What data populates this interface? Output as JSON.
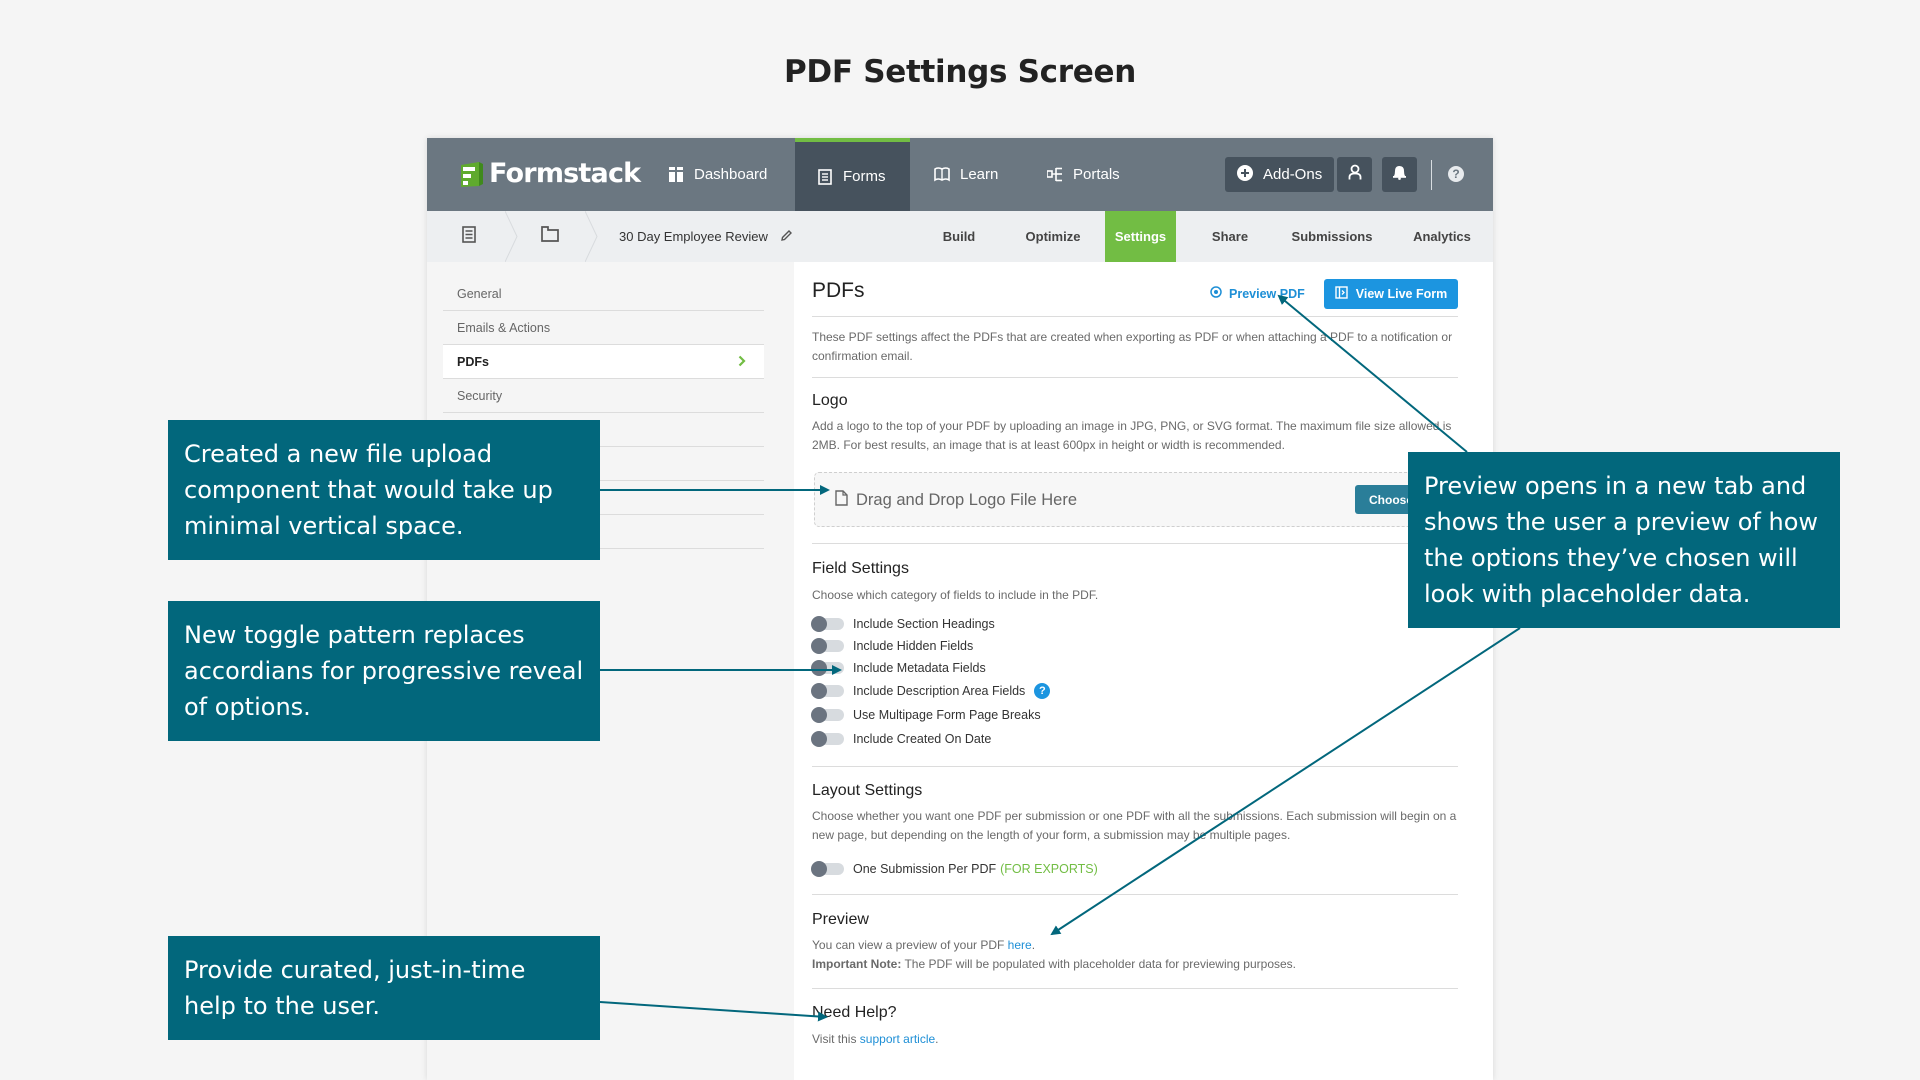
{
  "page_title": "PDF Settings Screen",
  "app": {
    "logo_text": "Formstack",
    "nav": [
      {
        "label": "Dashboard",
        "icon": "dashboard-icon",
        "active": false
      },
      {
        "label": "Forms",
        "icon": "forms-icon",
        "active": true
      },
      {
        "label": "Learn",
        "icon": "book-icon",
        "active": false
      },
      {
        "label": "Portals",
        "icon": "portals-icon",
        "active": false
      }
    ],
    "addons_label": "Add-Ons",
    "accent_green": "#72bd44",
    "accent_blue": "#1c95e0"
  },
  "subnav": {
    "form_name": "30 Day Employee Review",
    "tabs": [
      {
        "label": "Build",
        "active": false
      },
      {
        "label": "Optimize",
        "active": false
      },
      {
        "label": "Settings",
        "active": true
      },
      {
        "label": "Share",
        "active": false
      },
      {
        "label": "Submissions",
        "active": false
      },
      {
        "label": "Analytics",
        "active": false
      }
    ]
  },
  "sidebar": {
    "items": [
      {
        "label": "General",
        "active": false
      },
      {
        "label": "Emails & Actions",
        "active": false
      },
      {
        "label": "PDFs",
        "active": true
      },
      {
        "label": "Security",
        "active": false
      },
      {
        "label": "",
        "active": false
      },
      {
        "label": "",
        "active": false
      },
      {
        "label": "",
        "active": false
      },
      {
        "label": "",
        "active": false
      }
    ]
  },
  "main": {
    "title": "PDFs",
    "preview_pdf_label": "Preview PDF",
    "view_live_form_label": "View Live Form",
    "intro": "These PDF settings affect the PDFs that are created when exporting as PDF or when attaching a PDF to a notification or confirmation email.",
    "logo": {
      "heading": "Logo",
      "description": "Add a logo to the top of your PDF by uploading an image in JPG, PNG, or SVG format. The maximum file size allowed is 2MB. For best results, an image that is at least 600px in height or width is recommended.",
      "dropzone_text": "Drag and Drop Logo File Here",
      "choose_button": "Choose File"
    },
    "field_settings": {
      "heading": "Field Settings",
      "description": "Choose which category of fields to include in the PDF.",
      "toggles": [
        {
          "label": "Include Section Headings",
          "on": false
        },
        {
          "label": "Include Hidden Fields",
          "on": false
        },
        {
          "label": "Include Metadata Fields",
          "on": false
        },
        {
          "label": "Include Description Area Fields",
          "on": false,
          "help": true
        },
        {
          "label": "Use Multipage Form Page Breaks",
          "on": false
        },
        {
          "label": "Include Created On Date",
          "on": false
        }
      ]
    },
    "layout_settings": {
      "heading": "Layout Settings",
      "description": "Choose whether you want one PDF per submission or one PDF with all the submissions. Each submission will begin on a new page, but depending on the length of your form, a submission may be multiple pages.",
      "toggle_label": "One Submission Per PDF",
      "toggle_note": "(FOR EXPORTS)",
      "toggle_on": false
    },
    "preview": {
      "heading": "Preview",
      "line1_prefix": "You can view a preview of your PDF ",
      "line1_link": "here",
      "line1_suffix": ".",
      "note_label": "Important Note:",
      "note_text": " The PDF will be populated with placeholder data for previewing purposes."
    },
    "help": {
      "heading": "Need Help?",
      "prefix": "Visit this ",
      "link": "support article",
      "suffix": "."
    }
  },
  "callouts": [
    {
      "text": "Created a new file upload component that would take up minimal vertical space."
    },
    {
      "text": "New toggle pattern replaces accordians for progressive reveal of options."
    },
    {
      "text": "Preview opens in a new tab and shows the user a preview of how the options they’ve chosen will look with placeholder data."
    },
    {
      "text": "Provide curated, just-in-time help to the user."
    }
  ],
  "callout_color": "#02677c"
}
